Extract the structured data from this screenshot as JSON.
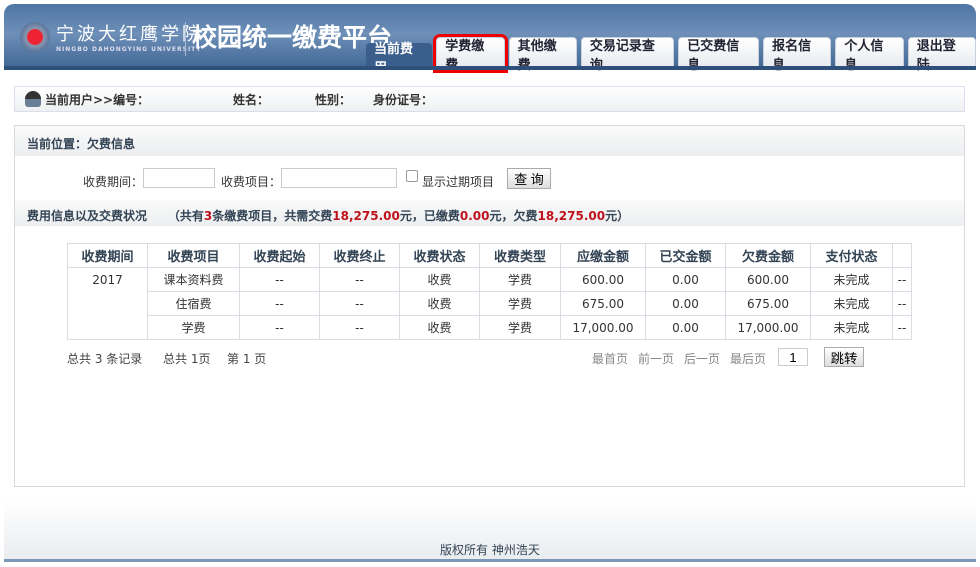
{
  "header": {
    "school_cn": "宁波大红鹰学院",
    "school_en": "NINGBO DAHONGYING UNIVERSITY",
    "platform": "校园统一缴费平台",
    "tabs": [
      {
        "label": "当前费用"
      },
      {
        "label": "学费缴费"
      },
      {
        "label": "其他缴费"
      },
      {
        "label": "交易记录查询"
      },
      {
        "label": "已交费信息"
      },
      {
        "label": "报名信息"
      },
      {
        "label": "个人信息"
      },
      {
        "label": "退出登陆"
      }
    ],
    "highlight_color": "#e00000"
  },
  "userbar": {
    "prefix": "当前用户>>编号：",
    "name": "姓名：",
    "gender": "性别：",
    "id": "身份证号："
  },
  "panel": {
    "location": "当前位置：欠费信息",
    "period_label": "收费期间：",
    "item_label": "收费项目：",
    "period_value": "",
    "item_value": "",
    "checkbox_label": "显示过期项目",
    "query": "查 询",
    "summary_title": "费用信息以及交费状况",
    "s1": "（共有",
    "count": "3",
    "s2": "条缴费项目，共需交费",
    "total": "18,275.00",
    "s3": "元，已缴费",
    "paid": "0.00",
    "s4": "元，欠费",
    "owed": "18,275.00",
    "s5": "元）"
  },
  "table": {
    "headers": [
      "收费期间",
      "收费项目",
      "收费起始",
      "收费终止",
      "收费状态",
      "收费类型",
      "应缴金额",
      "已交金额",
      "欠费金额",
      "支付状态",
      ""
    ],
    "period": "2017",
    "rows": [
      [
        "课本资料费",
        "--",
        "--",
        "收费",
        "学费",
        "600.00",
        "0.00",
        "600.00",
        "未完成",
        "--"
      ],
      [
        "住宿费",
        "--",
        "--",
        "收费",
        "学费",
        "675.00",
        "0.00",
        "675.00",
        "未完成",
        "--"
      ],
      [
        "学费",
        "--",
        "--",
        "收费",
        "学费",
        "17,000.00",
        "0.00",
        "17,000.00",
        "未完成",
        "--"
      ]
    ]
  },
  "pager": {
    "records": "总共 3 条记录",
    "pages": "总共 1页",
    "current": "第 1 页",
    "first": "最首页",
    "prev": "前一页",
    "next": "后一页",
    "last": "最后页",
    "page_value": "1",
    "jump": "跳转"
  },
  "footer": {
    "copyright": "版权所有 神州浩天"
  }
}
